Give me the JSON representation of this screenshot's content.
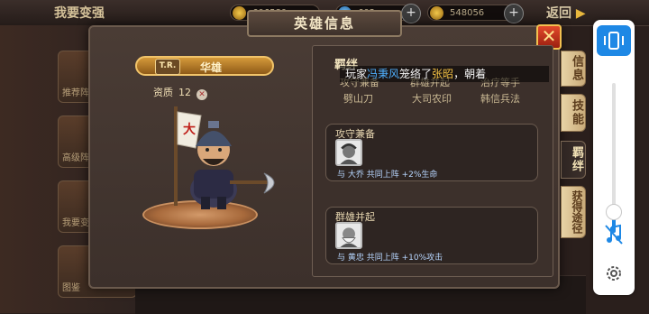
{
  "background": {
    "page_title": "我要变强",
    "resources": [
      {
        "name": "gold",
        "value": "606580"
      },
      {
        "name": "gems",
        "value": "602"
      },
      {
        "name": "coins",
        "value": "548056"
      }
    ],
    "back_label": "返回",
    "left_cards": [
      "推荐阵",
      "高级阵",
      "我要变",
      "图鉴"
    ]
  },
  "dialog": {
    "title": "英雄信息",
    "close_label": "✕",
    "hero": {
      "tier": "T.R.",
      "name": "华雄",
      "quality_label": "资质",
      "quality_value": "12"
    },
    "detail": {
      "heading": "羁绊",
      "top_row": [
        "攻守兼备",
        "群雄并起",
        "治疗等手"
      ],
      "second_row": [
        "劈山刀",
        "大司农印",
        "韩信兵法"
      ],
      "marquee": {
        "prefix": "玩家",
        "player": "冯秉风",
        "middle": "笼络了",
        "hero": "张昭",
        "suffix": "，朝着"
      },
      "bonds": [
        {
          "title": "攻守兼备",
          "description": "与 大乔 共同上阵 +2%生命"
        },
        {
          "title": "群雄并起",
          "description": "与 黄忠 共同上阵 +10%攻击"
        }
      ]
    },
    "tabs": [
      {
        "label": "信息",
        "active": false
      },
      {
        "label": "技能",
        "active": false
      },
      {
        "label": "羁绊",
        "active": true
      },
      {
        "label": "获得途径",
        "active": false
      }
    ]
  },
  "toolbar": {
    "volume_level": 0.14,
    "accent": "#1e88e5"
  }
}
